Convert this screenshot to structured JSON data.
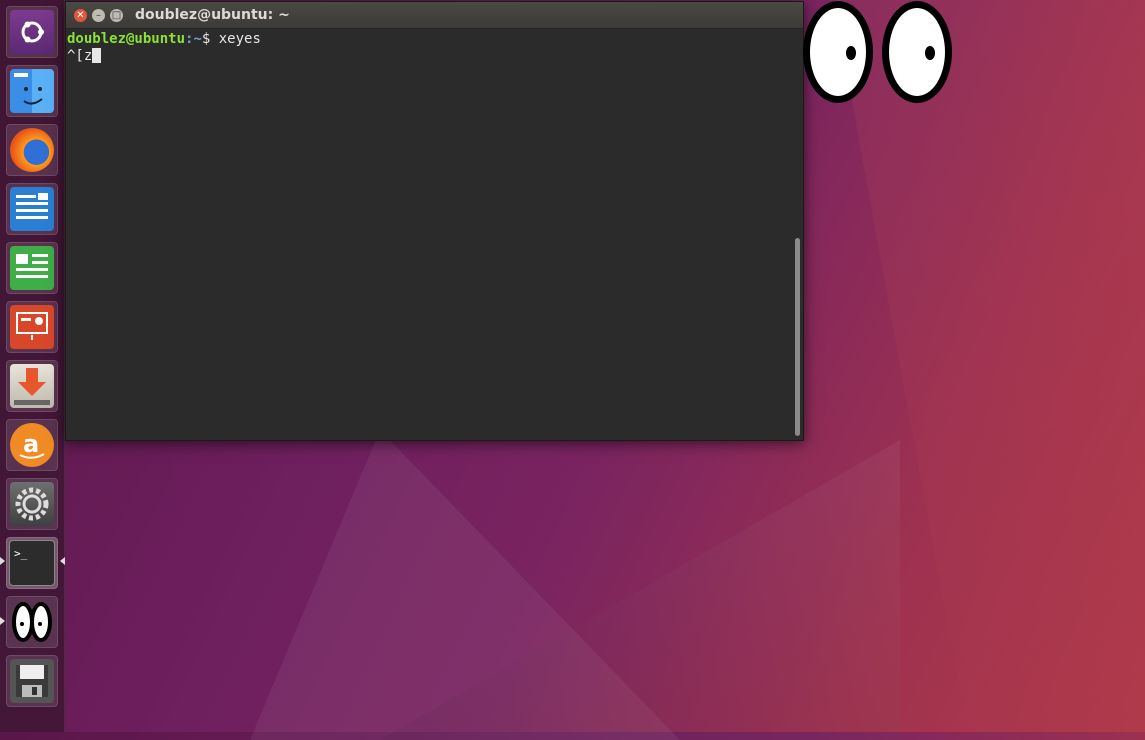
{
  "window": {
    "title": "doublez@ubuntu: ~"
  },
  "terminal": {
    "prompt_user": "doublez@ubuntu",
    "prompt_path": ":~",
    "prompt_symbol": "$ ",
    "command": "xeyes",
    "second_line": "^[z"
  },
  "launcher": {
    "items": [
      {
        "name": "ubuntu-dash",
        "icon": "ubuntu-logo-icon"
      },
      {
        "name": "files",
        "icon": "files-icon"
      },
      {
        "name": "firefox",
        "icon": "firefox-icon"
      },
      {
        "name": "libreoffice-writer",
        "icon": "writer-icon"
      },
      {
        "name": "libreoffice-calc",
        "icon": "calc-icon"
      },
      {
        "name": "libreoffice-impress",
        "icon": "impress-icon"
      },
      {
        "name": "software-center",
        "icon": "software-icon"
      },
      {
        "name": "amazon",
        "icon": "amazon-icon"
      },
      {
        "name": "system-settings",
        "icon": "settings-icon"
      },
      {
        "name": "terminal",
        "icon": "terminal-icon"
      },
      {
        "name": "xeyes",
        "icon": "xeyes-icon"
      },
      {
        "name": "save",
        "icon": "floppy-icon"
      }
    ]
  },
  "colors": {
    "prompt_user": "#8ae234",
    "prompt_path": "#729fcf",
    "terminal_bg": "#2b2b2b"
  }
}
